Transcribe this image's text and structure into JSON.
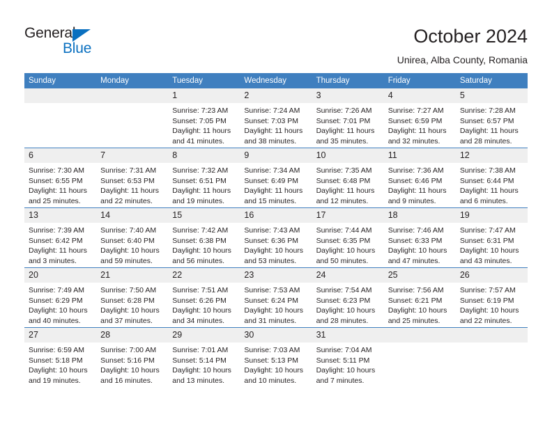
{
  "brand": {
    "name_top": "General",
    "name_bottom": "Blue",
    "accent_color": "#0a70c0",
    "triangle_icon": "triangle-icon"
  },
  "header": {
    "title": "October 2024",
    "subtitle": "Unirea, Alba County, Romania"
  },
  "theme": {
    "header_blue": "#3f7fbf",
    "daynum_band": "#efefef",
    "text": "#231f20"
  },
  "weekday_headers": [
    "Sunday",
    "Monday",
    "Tuesday",
    "Wednesday",
    "Thursday",
    "Friday",
    "Saturday"
  ],
  "labels": {
    "sunrise_prefix": "Sunrise:",
    "sunset_prefix": "Sunset:",
    "daylight_prefix": "Daylight:"
  },
  "weeks": [
    [
      {
        "day": "",
        "empty": true,
        "l1": "",
        "l2": "",
        "l3": "",
        "l4": ""
      },
      {
        "day": "",
        "empty": true,
        "l1": "",
        "l2": "",
        "l3": "",
        "l4": ""
      },
      {
        "day": "1",
        "l1": "Sunrise: 7:23 AM",
        "l2": "Sunset: 7:05 PM",
        "l3": "Daylight: 11 hours",
        "l4": "and 41 minutes."
      },
      {
        "day": "2",
        "l1": "Sunrise: 7:24 AM",
        "l2": "Sunset: 7:03 PM",
        "l3": "Daylight: 11 hours",
        "l4": "and 38 minutes."
      },
      {
        "day": "3",
        "l1": "Sunrise: 7:26 AM",
        "l2": "Sunset: 7:01 PM",
        "l3": "Daylight: 11 hours",
        "l4": "and 35 minutes."
      },
      {
        "day": "4",
        "l1": "Sunrise: 7:27 AM",
        "l2": "Sunset: 6:59 PM",
        "l3": "Daylight: 11 hours",
        "l4": "and 32 minutes."
      },
      {
        "day": "5",
        "l1": "Sunrise: 7:28 AM",
        "l2": "Sunset: 6:57 PM",
        "l3": "Daylight: 11 hours",
        "l4": "and 28 minutes."
      }
    ],
    [
      {
        "day": "6",
        "l1": "Sunrise: 7:30 AM",
        "l2": "Sunset: 6:55 PM",
        "l3": "Daylight: 11 hours",
        "l4": "and 25 minutes."
      },
      {
        "day": "7",
        "l1": "Sunrise: 7:31 AM",
        "l2": "Sunset: 6:53 PM",
        "l3": "Daylight: 11 hours",
        "l4": "and 22 minutes."
      },
      {
        "day": "8",
        "l1": "Sunrise: 7:32 AM",
        "l2": "Sunset: 6:51 PM",
        "l3": "Daylight: 11 hours",
        "l4": "and 19 minutes."
      },
      {
        "day": "9",
        "l1": "Sunrise: 7:34 AM",
        "l2": "Sunset: 6:49 PM",
        "l3": "Daylight: 11 hours",
        "l4": "and 15 minutes."
      },
      {
        "day": "10",
        "l1": "Sunrise: 7:35 AM",
        "l2": "Sunset: 6:48 PM",
        "l3": "Daylight: 11 hours",
        "l4": "and 12 minutes."
      },
      {
        "day": "11",
        "l1": "Sunrise: 7:36 AM",
        "l2": "Sunset: 6:46 PM",
        "l3": "Daylight: 11 hours",
        "l4": "and 9 minutes."
      },
      {
        "day": "12",
        "l1": "Sunrise: 7:38 AM",
        "l2": "Sunset: 6:44 PM",
        "l3": "Daylight: 11 hours",
        "l4": "and 6 minutes."
      }
    ],
    [
      {
        "day": "13",
        "l1": "Sunrise: 7:39 AM",
        "l2": "Sunset: 6:42 PM",
        "l3": "Daylight: 11 hours",
        "l4": "and 3 minutes."
      },
      {
        "day": "14",
        "l1": "Sunrise: 7:40 AM",
        "l2": "Sunset: 6:40 PM",
        "l3": "Daylight: 10 hours",
        "l4": "and 59 minutes."
      },
      {
        "day": "15",
        "l1": "Sunrise: 7:42 AM",
        "l2": "Sunset: 6:38 PM",
        "l3": "Daylight: 10 hours",
        "l4": "and 56 minutes."
      },
      {
        "day": "16",
        "l1": "Sunrise: 7:43 AM",
        "l2": "Sunset: 6:36 PM",
        "l3": "Daylight: 10 hours",
        "l4": "and 53 minutes."
      },
      {
        "day": "17",
        "l1": "Sunrise: 7:44 AM",
        "l2": "Sunset: 6:35 PM",
        "l3": "Daylight: 10 hours",
        "l4": "and 50 minutes."
      },
      {
        "day": "18",
        "l1": "Sunrise: 7:46 AM",
        "l2": "Sunset: 6:33 PM",
        "l3": "Daylight: 10 hours",
        "l4": "and 47 minutes."
      },
      {
        "day": "19",
        "l1": "Sunrise: 7:47 AM",
        "l2": "Sunset: 6:31 PM",
        "l3": "Daylight: 10 hours",
        "l4": "and 43 minutes."
      }
    ],
    [
      {
        "day": "20",
        "l1": "Sunrise: 7:49 AM",
        "l2": "Sunset: 6:29 PM",
        "l3": "Daylight: 10 hours",
        "l4": "and 40 minutes."
      },
      {
        "day": "21",
        "l1": "Sunrise: 7:50 AM",
        "l2": "Sunset: 6:28 PM",
        "l3": "Daylight: 10 hours",
        "l4": "and 37 minutes."
      },
      {
        "day": "22",
        "l1": "Sunrise: 7:51 AM",
        "l2": "Sunset: 6:26 PM",
        "l3": "Daylight: 10 hours",
        "l4": "and 34 minutes."
      },
      {
        "day": "23",
        "l1": "Sunrise: 7:53 AM",
        "l2": "Sunset: 6:24 PM",
        "l3": "Daylight: 10 hours",
        "l4": "and 31 minutes."
      },
      {
        "day": "24",
        "l1": "Sunrise: 7:54 AM",
        "l2": "Sunset: 6:23 PM",
        "l3": "Daylight: 10 hours",
        "l4": "and 28 minutes."
      },
      {
        "day": "25",
        "l1": "Sunrise: 7:56 AM",
        "l2": "Sunset: 6:21 PM",
        "l3": "Daylight: 10 hours",
        "l4": "and 25 minutes."
      },
      {
        "day": "26",
        "l1": "Sunrise: 7:57 AM",
        "l2": "Sunset: 6:19 PM",
        "l3": "Daylight: 10 hours",
        "l4": "and 22 minutes."
      }
    ],
    [
      {
        "day": "27",
        "l1": "Sunrise: 6:59 AM",
        "l2": "Sunset: 5:18 PM",
        "l3": "Daylight: 10 hours",
        "l4": "and 19 minutes."
      },
      {
        "day": "28",
        "l1": "Sunrise: 7:00 AM",
        "l2": "Sunset: 5:16 PM",
        "l3": "Daylight: 10 hours",
        "l4": "and 16 minutes."
      },
      {
        "day": "29",
        "l1": "Sunrise: 7:01 AM",
        "l2": "Sunset: 5:14 PM",
        "l3": "Daylight: 10 hours",
        "l4": "and 13 minutes."
      },
      {
        "day": "30",
        "l1": "Sunrise: 7:03 AM",
        "l2": "Sunset: 5:13 PM",
        "l3": "Daylight: 10 hours",
        "l4": "and 10 minutes."
      },
      {
        "day": "31",
        "l1": "Sunrise: 7:04 AM",
        "l2": "Sunset: 5:11 PM",
        "l3": "Daylight: 10 hours",
        "l4": "and 7 minutes."
      },
      {
        "day": "",
        "empty": true,
        "l1": "",
        "l2": "",
        "l3": "",
        "l4": ""
      },
      {
        "day": "",
        "empty": true,
        "l1": "",
        "l2": "",
        "l3": "",
        "l4": ""
      }
    ]
  ]
}
